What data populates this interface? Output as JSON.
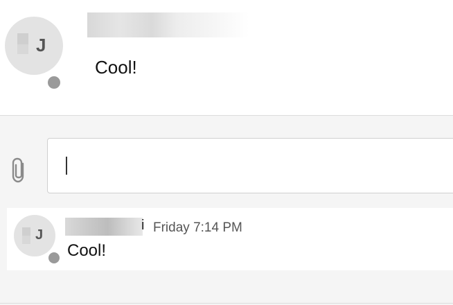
{
  "top_message": {
    "avatar_initial": "J",
    "text": "Cool!"
  },
  "composer": {
    "attach_icon": "paperclip-icon",
    "input_value": ""
  },
  "preview_message": {
    "avatar_initial": "J",
    "name_visible_tail": "i",
    "timestamp": "Friday 7:14 PM",
    "text": "Cool!"
  },
  "colors": {
    "status_dot": "#9a9a9a",
    "avatar_bg": "#e3e3e3",
    "panel_bg": "#f5f5f5"
  }
}
